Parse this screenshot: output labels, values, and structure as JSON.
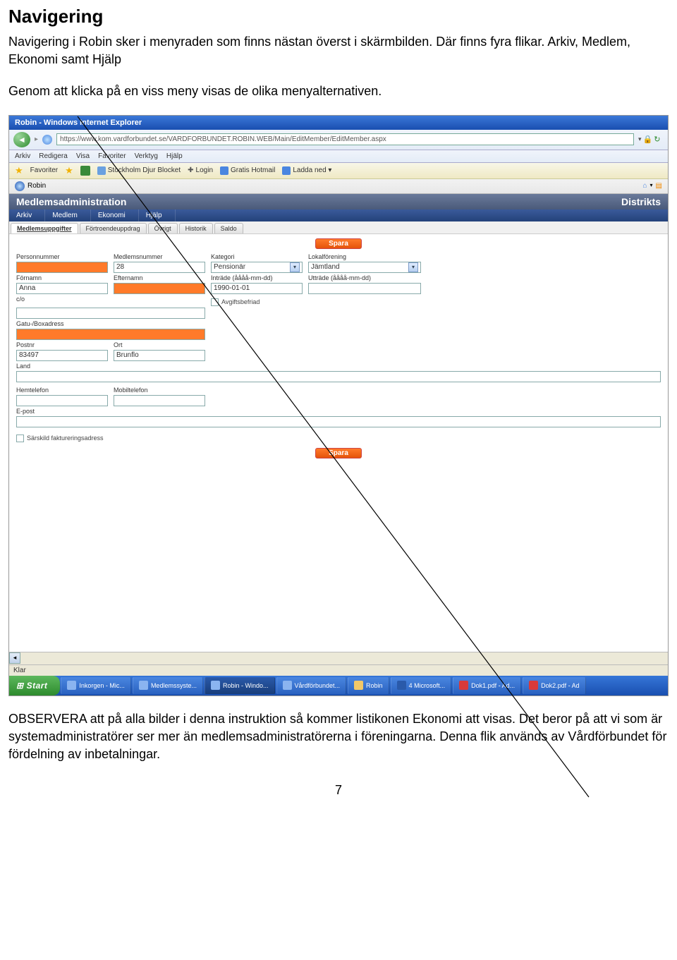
{
  "doc": {
    "title": "Navigering",
    "p1": "Navigering i Robin sker i menyraden som finns nästan överst i skärmbilden. Där finns fyra flikar. Arkiv, Medlem, Ekonomi samt Hjälp",
    "p2": "Genom att klicka på en viss meny visas de olika menyalternativen.",
    "obs": "OBSERVERA att på alla bilder i denna instruktion så kommer listikonen Ekonomi att visas. Det beror på att vi som är systemadministratörer ser mer än medlemsadministratörerna i föreningarna. Denna flik används av Vårdförbundet för fördelning av inbetalningar.",
    "pagenum": "7"
  },
  "ie": {
    "title": "Robin - Windows Internet Explorer",
    "url": "https://www.kom.vardforbundet.se/VARDFORBUNDET.ROBIN.WEB/Main/EditMember/EditMember.aspx",
    "menu": [
      "Arkiv",
      "Redigera",
      "Visa",
      "Favoriter",
      "Verktyg",
      "Hjälp"
    ],
    "fav_label": "Favoriter",
    "fav_links": [
      "Stockholm  Djur  Blocket",
      "Login",
      "Gratis Hotmail",
      "Ladda ned ▾"
    ],
    "tab_label": "Robin"
  },
  "app": {
    "header": "Medlemsadministration",
    "header_right": "Distrikts",
    "menu": [
      "Arkiv",
      "Medlem",
      "Ekonomi",
      "Hjälp"
    ],
    "subtabs": [
      "Medlemsuppgifter",
      "Förtroendeuppdrag",
      "Övrigt",
      "Historik",
      "Saldo"
    ],
    "spara": "Spara",
    "labels": {
      "personnummer": "Personnummer",
      "medlemsnummer": "Medlemsnummer",
      "kategori": "Kategori",
      "lokalforening": "Lokalförening",
      "fornamn": "Förnamn",
      "efternamn": "Efternamn",
      "intrade": "Inträde (åååå-mm-dd)",
      "uttrade": "Utträde (åååå-mm-dd)",
      "co": "c/o",
      "avgift": "Avgiftsbefriad",
      "gatu": "Gatu-/Boxadress",
      "postnr": "Postnr",
      "ort": "Ort",
      "land": "Land",
      "hemtel": "Hemtelefon",
      "mobil": "Mobiltelefon",
      "epost": "E-post",
      "sarskild": "Särskild faktureringsadress"
    },
    "values": {
      "medlemsnummer": "28",
      "kategori": "Pensionär",
      "lokalforening": "Jämtland",
      "fornamn": "Anna",
      "intrade": "1990-01-01",
      "postnr": "83497",
      "ort": "Brunflo"
    }
  },
  "status": {
    "klar": "Klar"
  },
  "taskbar": {
    "start": "Start",
    "items": [
      {
        "label": "Inkorgen - Mic..."
      },
      {
        "label": "Medlemssyste..."
      },
      {
        "label": "Robin - Windo..."
      },
      {
        "label": "Vårdförbundet..."
      },
      {
        "label": "Robin"
      },
      {
        "label": "4 Microsoft..."
      },
      {
        "label": "Dok1.pdf - Ad..."
      },
      {
        "label": "Dok2.pdf - Ad"
      }
    ]
  }
}
